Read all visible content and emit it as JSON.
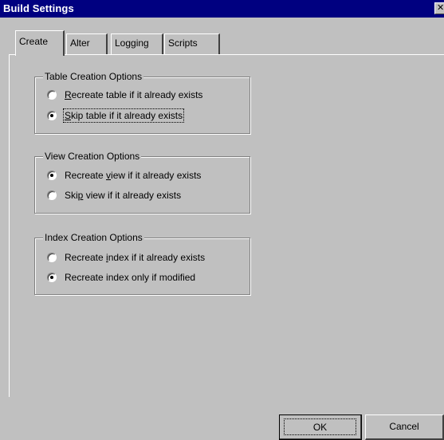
{
  "window": {
    "title": "Build Settings",
    "close_glyph": "✕"
  },
  "tabs": [
    {
      "label": "Create",
      "active": true
    },
    {
      "label": "Alter",
      "active": false
    },
    {
      "label": "Logging",
      "active": false
    },
    {
      "label": "Scripts",
      "active": false
    }
  ],
  "groups": {
    "table": {
      "label": "Table Creation Options",
      "options": [
        {
          "label_pre": "",
          "mnemonic": "R",
          "label_post": "ecreate table if it already exists",
          "selected": false
        },
        {
          "label_pre": "",
          "mnemonic": "S",
          "label_post": "kip table if it already exists",
          "selected": true
        }
      ]
    },
    "view": {
      "label": "View Creation Options",
      "options": [
        {
          "label_pre": "Recreate ",
          "mnemonic": "v",
          "label_post": "iew if it already exists",
          "selected": true
        },
        {
          "label_pre": "Ski",
          "mnemonic": "p",
          "label_post": " view if it already exists",
          "selected": false
        }
      ]
    },
    "index": {
      "label": "Index Creation Options",
      "options": [
        {
          "label_pre": "Recreate ",
          "mnemonic": "i",
          "label_post": "ndex if it already exists",
          "selected": false
        },
        {
          "label_pre": "Recreate index only if modified",
          "mnemonic": "",
          "label_post": "",
          "selected": true
        }
      ]
    }
  },
  "buttons": {
    "ok": "OK",
    "cancel": "Cancel"
  }
}
